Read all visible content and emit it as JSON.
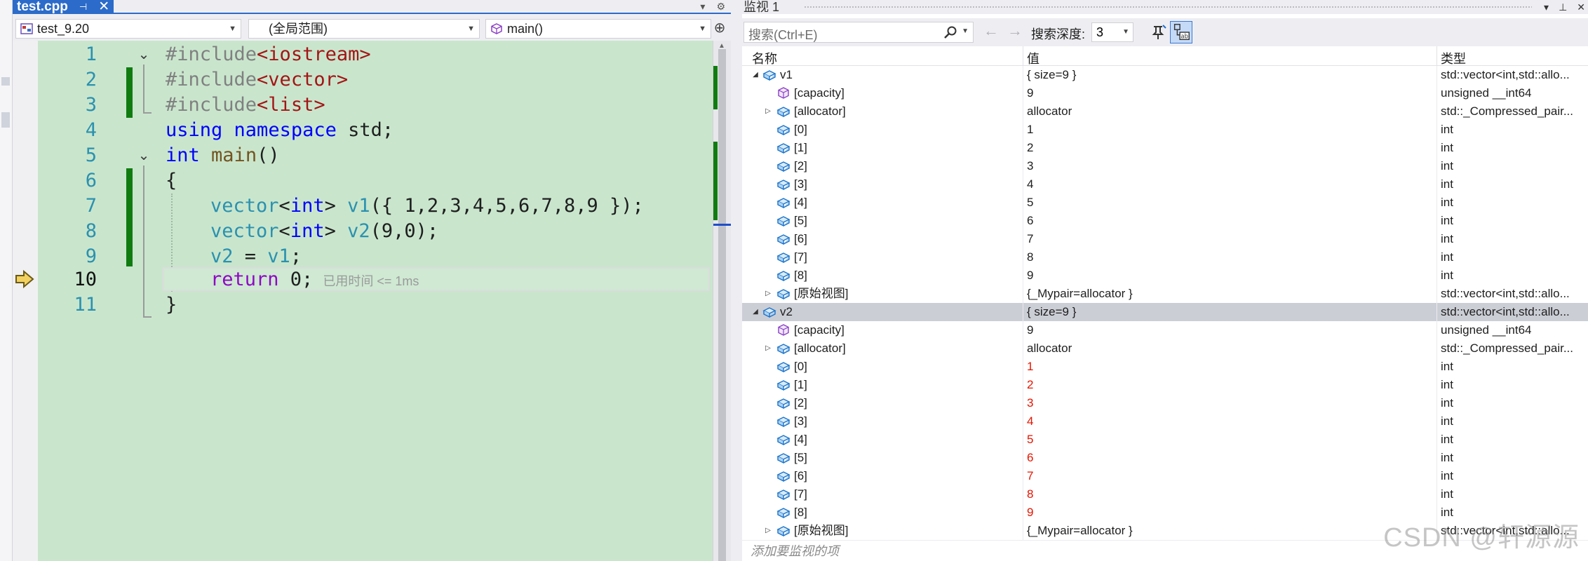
{
  "editor": {
    "tab_title": "test.cpp",
    "tab_pin_glyph": "⊣",
    "tab_close_glyph": "✕",
    "project_combo": "test_9.20",
    "scope_combo": "(全局范围)",
    "function_combo": "main()",
    "lines": [
      {
        "no": "1"
      },
      {
        "no": "2"
      },
      {
        "no": "3"
      },
      {
        "no": "4"
      },
      {
        "no": "5"
      },
      {
        "no": "6"
      },
      {
        "no": "7"
      },
      {
        "no": "8"
      },
      {
        "no": "9"
      },
      {
        "no": "10"
      },
      {
        "no": "11"
      }
    ],
    "code": {
      "l1_pp": "#include",
      "l1_str": "<iostream>",
      "l2_pp": "#include",
      "l2_str": "<vector>",
      "l3_pp": "#include",
      "l3_str": "<list>",
      "l4_kw1": "using",
      "l4_kw2": "namespace",
      "l4_rest": " std;",
      "l5_kw": "int",
      "l5_fn": "main",
      "l5_rest": "()",
      "l6": "{",
      "l7_type": "vector",
      "l7_lt": "<",
      "l7_kw": "int",
      "l7_gt": "> ",
      "l7_var": "v1",
      "l7_rest": "({ 1,2,3,4,5,6,7,8,9 });",
      "l8_type": "vector",
      "l8_lt": "<",
      "l8_kw": "int",
      "l8_gt": "> ",
      "l8_var": "v2",
      "l8_rest": "(9,0);",
      "l9_var1": "v2",
      "l9_mid": " = ",
      "l9_var2": "v1",
      "l9_rest": ";",
      "l10_ret": "return",
      "l10_rest": " 0;",
      "l10_hint": "已用时间 <= 1ms",
      "l11": "}"
    }
  },
  "watch": {
    "title": "监视 1",
    "search_placeholder": "搜索(Ctrl+E)",
    "depth_label": "搜索深度:",
    "depth_value": "3",
    "headers": {
      "name": "名称",
      "value": "值",
      "type": "类型"
    },
    "rows": [
      {
        "name": "v1",
        "value": "{ size=9 }",
        "type": "std::vector<int,std::allo..."
      },
      {
        "name": "[capacity]",
        "value": "9",
        "type": "unsigned __int64"
      },
      {
        "name": "[allocator]",
        "value": "allocator",
        "type": "std::_Compressed_pair..."
      },
      {
        "name": "[0]",
        "value": "1",
        "type": "int"
      },
      {
        "name": "[1]",
        "value": "2",
        "type": "int"
      },
      {
        "name": "[2]",
        "value": "3",
        "type": "int"
      },
      {
        "name": "[3]",
        "value": "4",
        "type": "int"
      },
      {
        "name": "[4]",
        "value": "5",
        "type": "int"
      },
      {
        "name": "[5]",
        "value": "6",
        "type": "int"
      },
      {
        "name": "[6]",
        "value": "7",
        "type": "int"
      },
      {
        "name": "[7]",
        "value": "8",
        "type": "int"
      },
      {
        "name": "[8]",
        "value": "9",
        "type": "int"
      },
      {
        "name": "[原始视图]",
        "value": "{_Mypair=allocator }",
        "type": "std::vector<int,std::allo..."
      },
      {
        "name": "v2",
        "value": "{ size=9 }",
        "type": "std::vector<int,std::allo..."
      },
      {
        "name": "[capacity]",
        "value": "9",
        "type": "unsigned __int64"
      },
      {
        "name": "[allocator]",
        "value": "allocator",
        "type": "std::_Compressed_pair..."
      },
      {
        "name": "[0]",
        "value": "1",
        "type": "int"
      },
      {
        "name": "[1]",
        "value": "2",
        "type": "int"
      },
      {
        "name": "[2]",
        "value": "3",
        "type": "int"
      },
      {
        "name": "[3]",
        "value": "4",
        "type": "int"
      },
      {
        "name": "[4]",
        "value": "5",
        "type": "int"
      },
      {
        "name": "[5]",
        "value": "6",
        "type": "int"
      },
      {
        "name": "[6]",
        "value": "7",
        "type": "int"
      },
      {
        "name": "[7]",
        "value": "8",
        "type": "int"
      },
      {
        "name": "[8]",
        "value": "9",
        "type": "int"
      },
      {
        "name": "[原始视图]",
        "value": "{_Mypair=allocator }",
        "type": "std::vector<int,std::allo..."
      }
    ],
    "add_item_placeholder": "添加要监视的项"
  },
  "watermark": "CSDN @轩源源"
}
